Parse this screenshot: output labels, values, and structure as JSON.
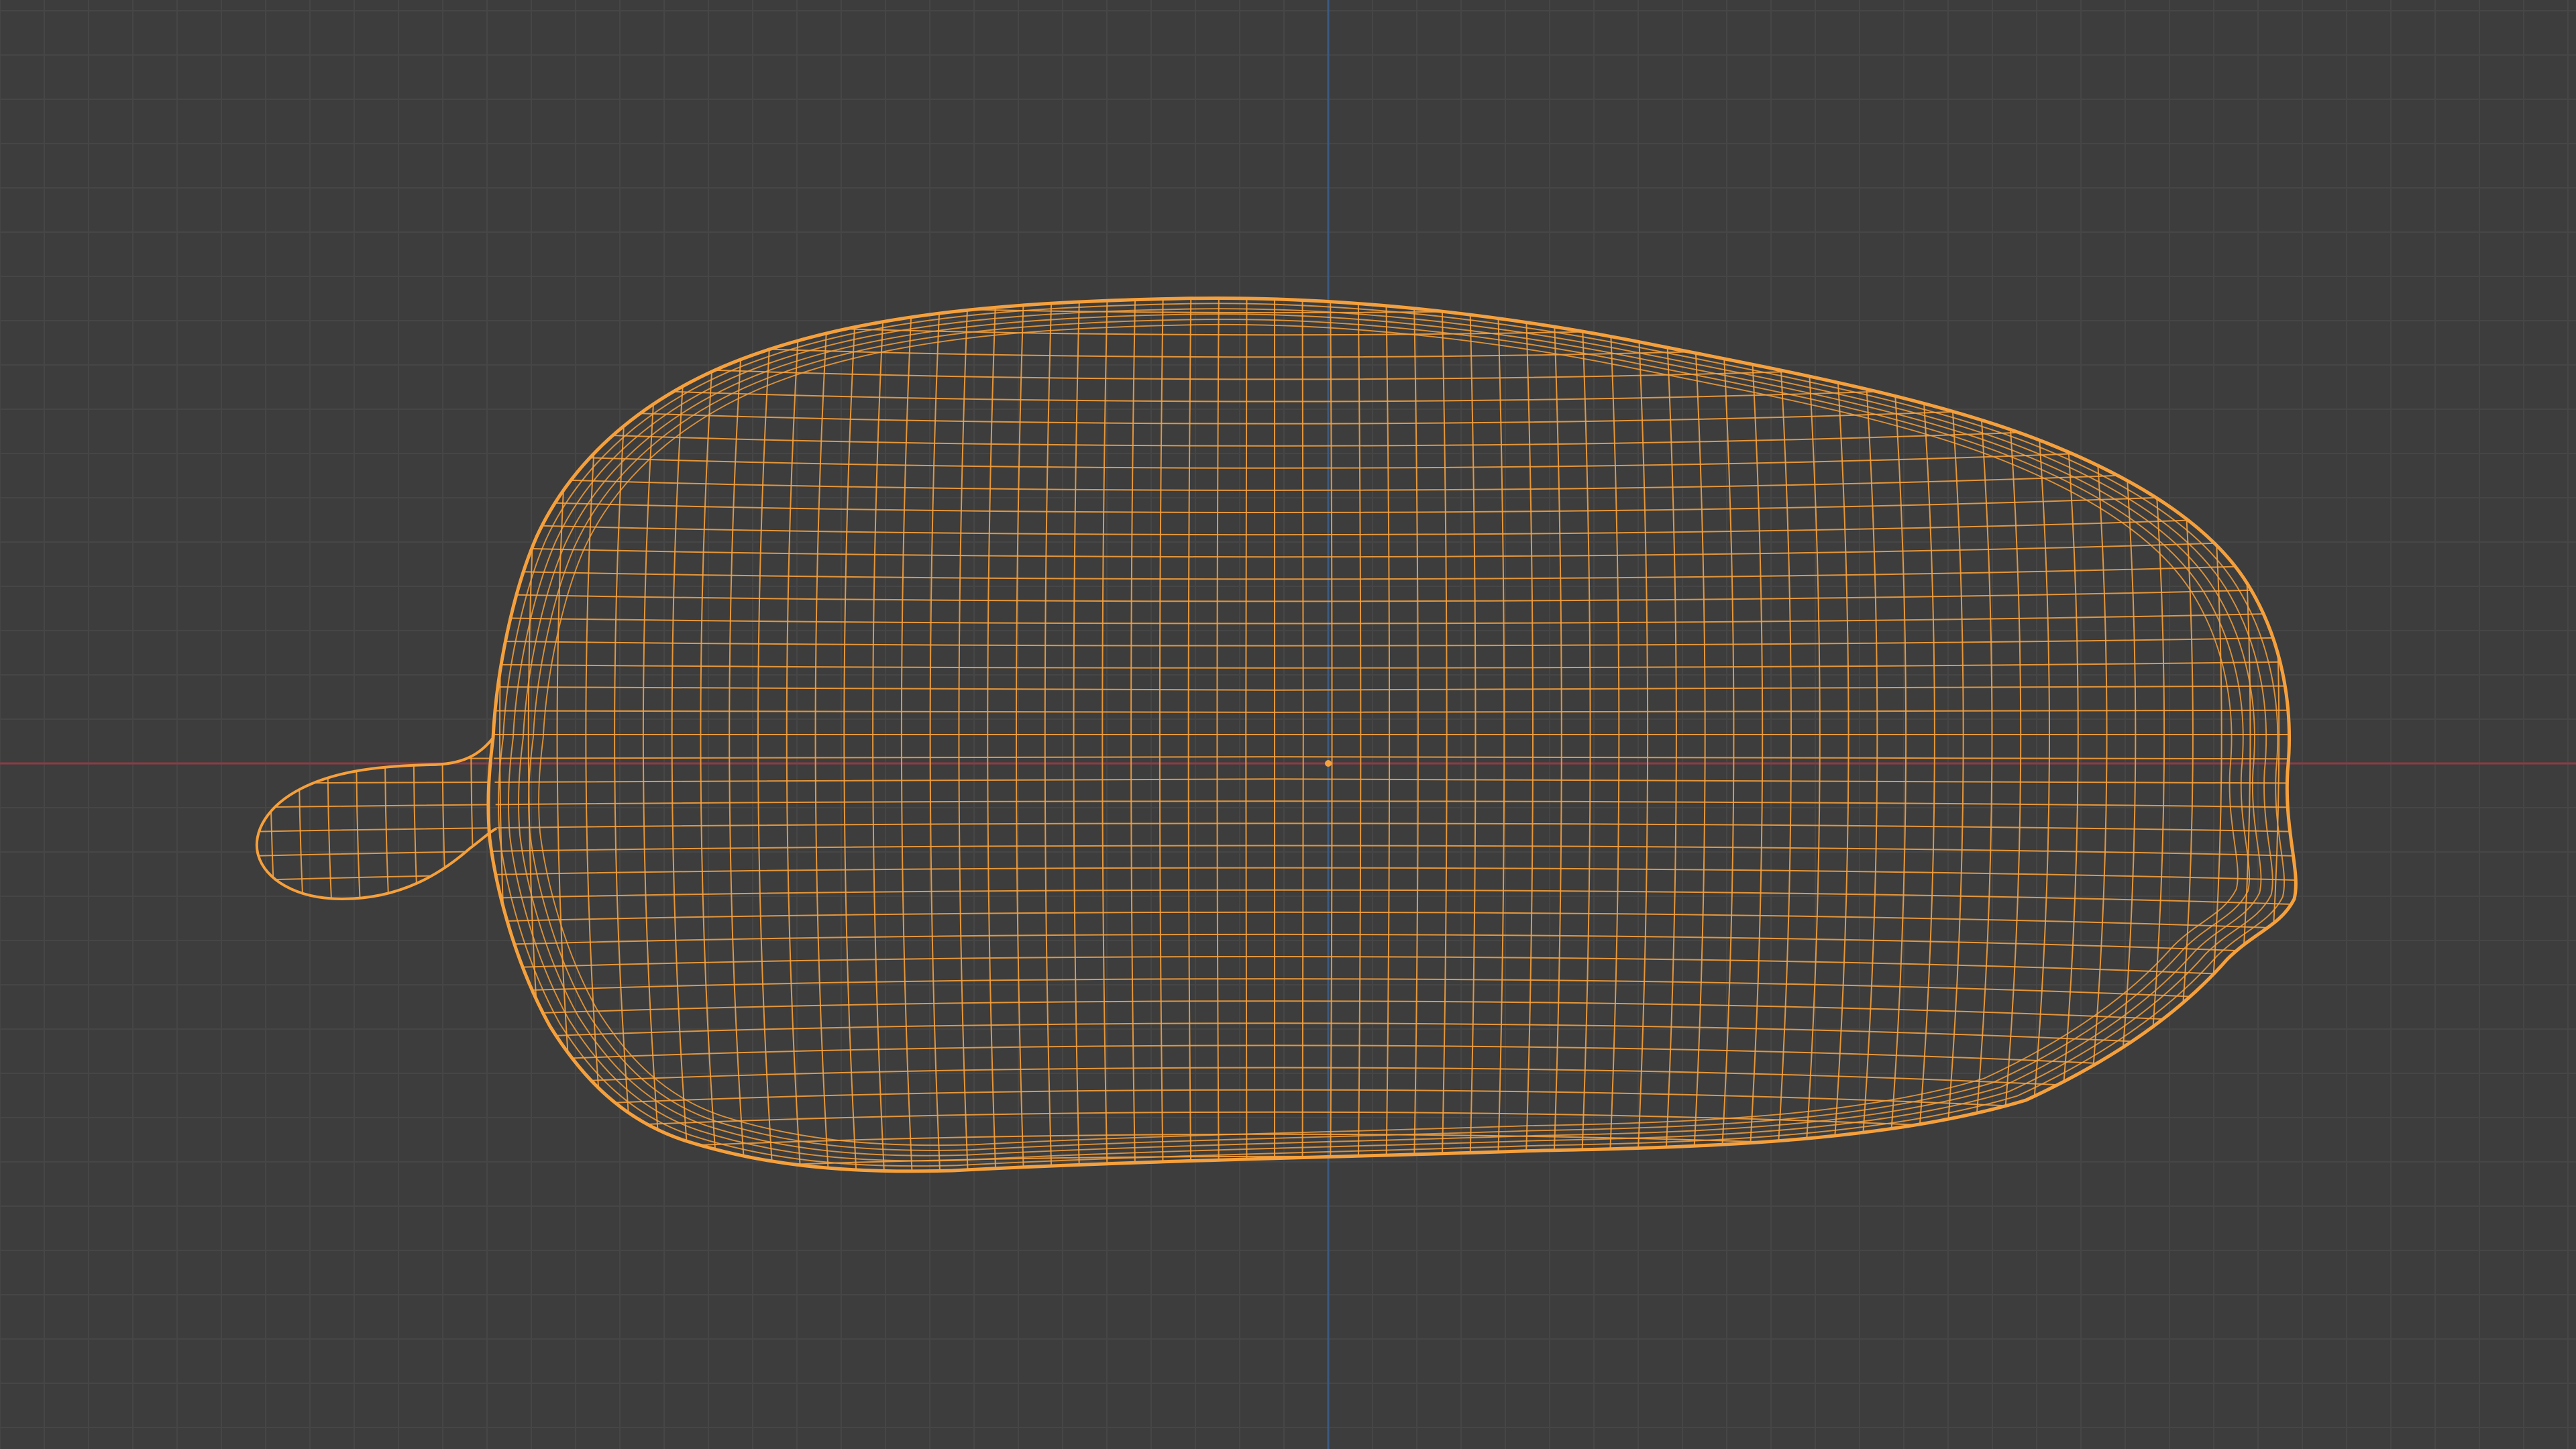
{
  "app": {
    "editor_type": "3D Viewport",
    "view_mode": "wireframe",
    "view_orientation": "orthographic-top"
  },
  "colors": {
    "background": "#3d3d3d",
    "grid_minor": "#464646",
    "grid_major": "#4c4c4c",
    "axis_x": "#8e3a44",
    "axis_y": "#3c5a80",
    "selected_wire": "#f5a03c",
    "origin_dot": "#f5a03c"
  },
  "scene": {
    "object": {
      "selected": true,
      "shading": "wireframe",
      "description_icon": "mesh-object-icon"
    }
  }
}
